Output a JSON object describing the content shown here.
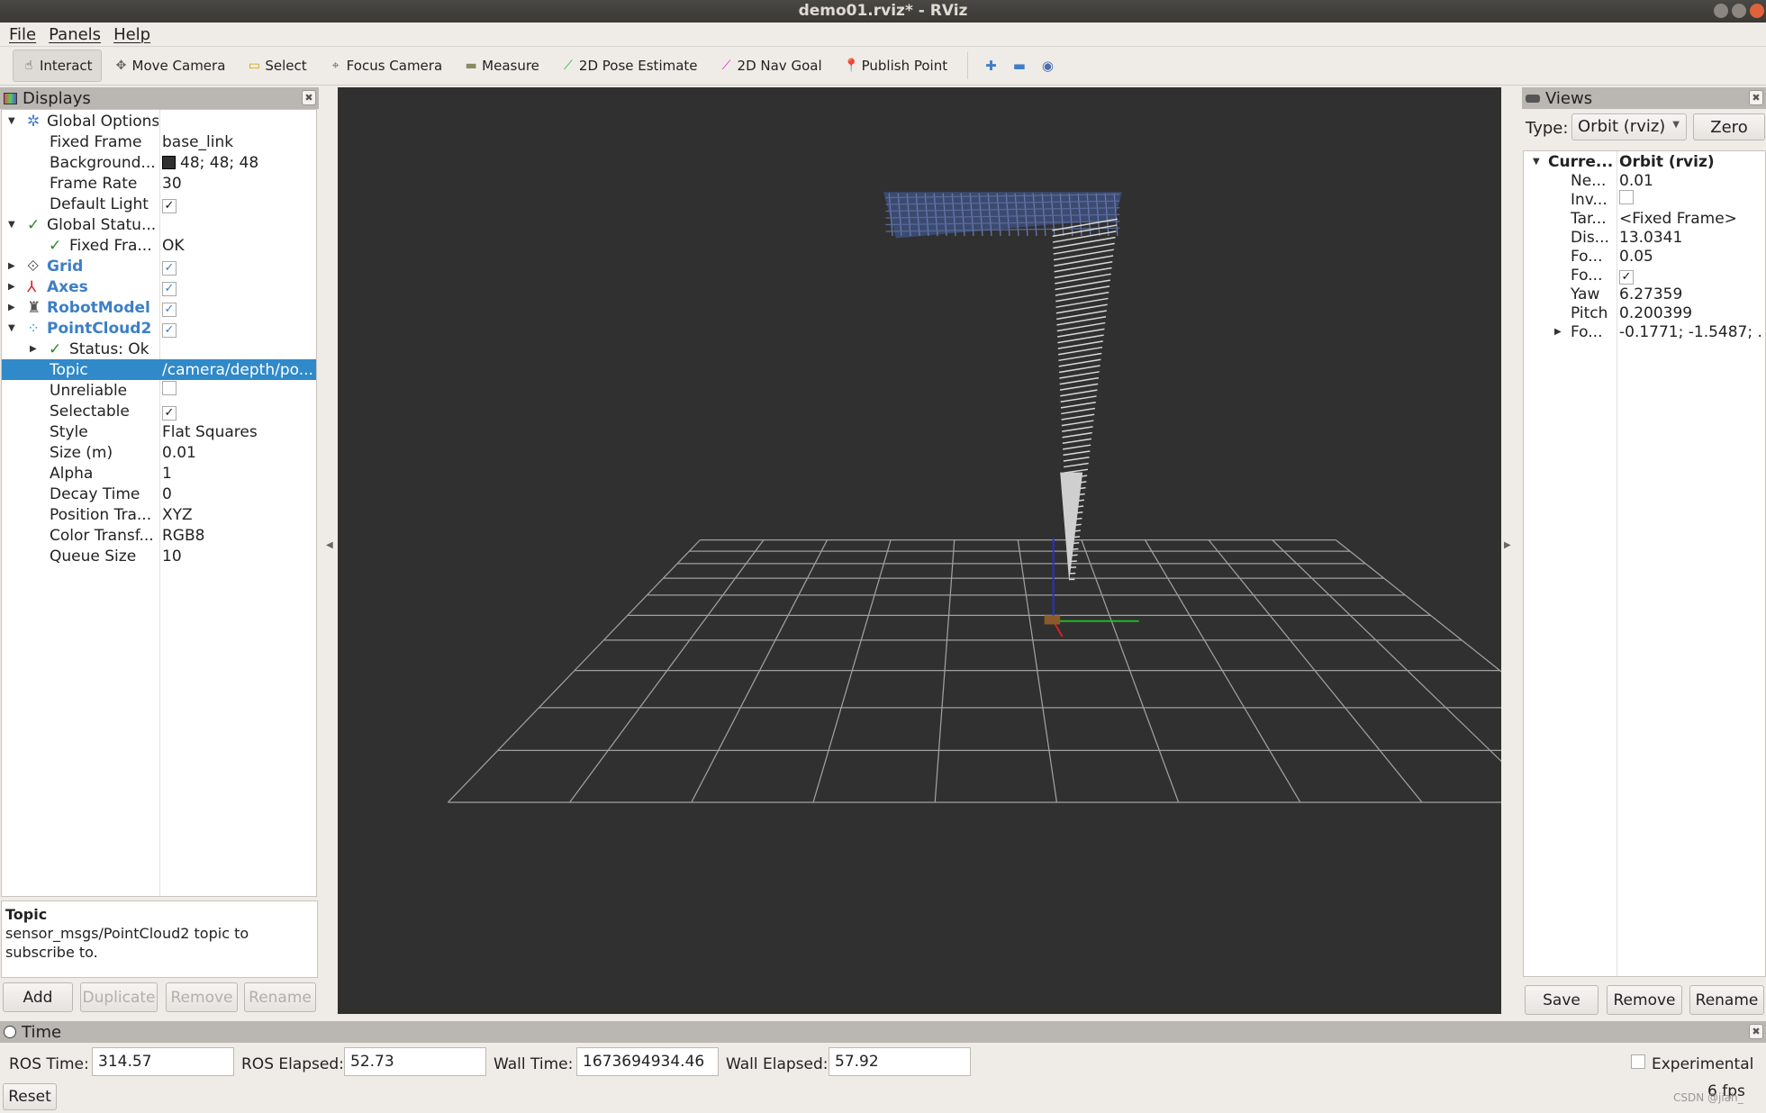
{
  "window": {
    "title": "demo01.rviz* - RViz"
  },
  "menu": [
    "File",
    "Panels",
    "Help"
  ],
  "toolbar": {
    "tools": [
      {
        "label": "Interact",
        "icon": "hand-icon",
        "active": true
      },
      {
        "label": "Move Camera",
        "icon": "move-camera-icon"
      },
      {
        "label": "Select",
        "icon": "select-icon"
      },
      {
        "label": "Focus Camera",
        "icon": "focus-camera-icon"
      },
      {
        "label": "Measure",
        "icon": "ruler-icon"
      },
      {
        "label": "2D Pose Estimate",
        "icon": "green-arrow-icon"
      },
      {
        "label": "2D Nav Goal",
        "icon": "magenta-arrow-icon"
      },
      {
        "label": "Publish Point",
        "icon": "map-pin-icon"
      }
    ],
    "extra": [
      "plus-icon",
      "minus-icon",
      "eye-icon"
    ]
  },
  "displays": {
    "title": "Displays",
    "rows": [
      {
        "key": "Global Options",
        "val": "",
        "indent": 1,
        "arrow": "down",
        "icon": "gear-icon"
      },
      {
        "key": "Fixed Frame",
        "val": "base_link",
        "indent": 2
      },
      {
        "key": "Background...",
        "val": "48; 48; 48",
        "indent": 2,
        "swatch": "#303030"
      },
      {
        "key": "Frame Rate",
        "val": "30",
        "indent": 2
      },
      {
        "key": "Default Light",
        "val": "",
        "indent": 2,
        "check": true
      },
      {
        "key": "Global Statu...",
        "val": "",
        "indent": 1,
        "arrow": "down",
        "icon": "check-icon"
      },
      {
        "key": "Fixed Fra...",
        "val": "OK",
        "indent": 2,
        "icon": "check-icon"
      },
      {
        "key": "Grid",
        "val": "",
        "indent": 1,
        "arrow": "right",
        "icon": "grid-icon",
        "blue": true,
        "check": true
      },
      {
        "key": "Axes",
        "val": "",
        "indent": 1,
        "arrow": "right",
        "icon": "axes-icon",
        "blue": true,
        "check": true
      },
      {
        "key": "RobotModel",
        "val": "",
        "indent": 1,
        "arrow": "right",
        "icon": "robot-icon",
        "blue": true,
        "check": true
      },
      {
        "key": "PointCloud2",
        "val": "",
        "indent": 1,
        "arrow": "down",
        "icon": "pointcloud-icon",
        "blue": true,
        "check": true
      },
      {
        "key": "Status: Ok",
        "val": "",
        "indent": 2,
        "arrow": "right",
        "icon": "check-icon"
      },
      {
        "key": "Topic",
        "val": "/camera/depth/po...",
        "indent": 2,
        "selected": true
      },
      {
        "key": "Unreliable",
        "val": "",
        "indent": 2,
        "check": false
      },
      {
        "key": "Selectable",
        "val": "",
        "indent": 2,
        "check": true
      },
      {
        "key": "Style",
        "val": "Flat Squares",
        "indent": 2
      },
      {
        "key": "Size (m)",
        "val": "0.01",
        "indent": 2
      },
      {
        "key": "Alpha",
        "val": "1",
        "indent": 2
      },
      {
        "key": "Decay Time",
        "val": "0",
        "indent": 2
      },
      {
        "key": "Position Tra...",
        "val": "XYZ",
        "indent": 2
      },
      {
        "key": "Color Transf...",
        "val": "RGB8",
        "indent": 2
      },
      {
        "key": "Queue Size",
        "val": "10",
        "indent": 2
      }
    ],
    "description": {
      "title": "Topic",
      "text": "sensor_msgs/PointCloud2 topic to subscribe to."
    },
    "buttons": [
      "Add",
      "Duplicate",
      "Remove",
      "Rename"
    ]
  },
  "views": {
    "title": "Views",
    "type_label": "Type:",
    "type_value": "Orbit (rviz)",
    "zero": "Zero",
    "rows": [
      {
        "key": "Curre...",
        "val": "Orbit (rviz)",
        "bold": true,
        "arrow": "down"
      },
      {
        "key": "Ne...",
        "val": "0.01"
      },
      {
        "key": "Inv...",
        "val": "",
        "check": false
      },
      {
        "key": "Tar...",
        "val": "<Fixed Frame>"
      },
      {
        "key": "Dis...",
        "val": "13.0341"
      },
      {
        "key": "Fo...",
        "val": "0.05"
      },
      {
        "key": "Fo...",
        "val": "",
        "check": true
      },
      {
        "key": "Yaw",
        "val": "6.27359"
      },
      {
        "key": "Pitch",
        "val": "0.200399"
      },
      {
        "key": "Fo...",
        "val": "-0.1771; -1.5487; ...",
        "arrow": "right"
      }
    ],
    "buttons": [
      "Save",
      "Remove",
      "Rename"
    ]
  },
  "time": {
    "title": "Time",
    "ros_time_label": "ROS Time:",
    "ros_time": "314.57",
    "ros_elapsed_label": "ROS Elapsed:",
    "ros_elapsed": "52.73",
    "wall_time_label": "Wall Time:",
    "wall_time": "1673694934.46",
    "wall_elapsed_label": "Wall Elapsed:",
    "wall_elapsed": "57.92",
    "experimental": "Experimental",
    "reset": "Reset",
    "fps": "6 fps"
  },
  "watermark": "CSDN @jiah_",
  "colors": {
    "background": "#303030",
    "selection": "#3089c8",
    "link_blue": "#3c7fc6"
  }
}
